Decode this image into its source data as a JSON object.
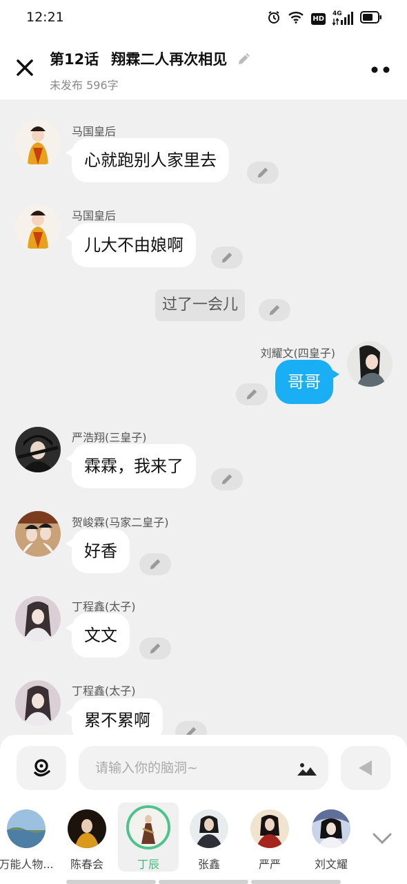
{
  "status_bar": {
    "time": "12:21",
    "network": "4G",
    "hd": "HD"
  },
  "header": {
    "chapter": "第12话",
    "title": "翔霖二人再次相见",
    "subtitle": "未发布 596字"
  },
  "messages": [
    {
      "speaker": "马国皇后",
      "text": "心就跑别人家里去"
    },
    {
      "speaker": "马国皇后",
      "text": "儿大不由娘啊"
    },
    {
      "narration": "过了一会儿"
    },
    {
      "speaker": "刘耀文(四皇子)",
      "text": "哥哥"
    },
    {
      "speaker": "严浩翔(三皇子)",
      "text": "霖霖，我来了"
    },
    {
      "speaker": "贺峻霖(马家二皇子)",
      "text": "好香"
    },
    {
      "speaker": "丁程鑫(太子)",
      "text": "文文"
    },
    {
      "speaker": "丁程鑫(太子)",
      "text": "累不累啊"
    }
  ],
  "input": {
    "placeholder": "请输入你的脑洞~"
  },
  "characters": [
    {
      "name": "万能人物..."
    },
    {
      "name": "陈春会"
    },
    {
      "name": "丁辰"
    },
    {
      "name": "张鑫"
    },
    {
      "name": "严严"
    },
    {
      "name": "刘文耀"
    }
  ],
  "colors": {
    "accent_blue": "#1aaef5",
    "active_green": "#4cc38a",
    "background": "#f0f0f0"
  }
}
